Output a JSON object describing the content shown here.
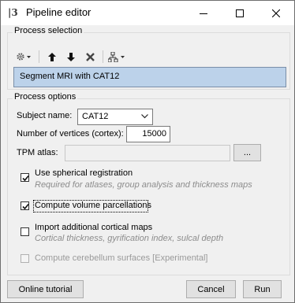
{
  "window": {
    "title": "Pipeline editor",
    "app_icon": "brainstorm-icon"
  },
  "process_selection": {
    "label": "Process selection",
    "selected_process": "Segment MRI with CAT12"
  },
  "process_options": {
    "label": "Process options",
    "subject_name_label": "Subject name:",
    "subject_name_value": "CAT12",
    "vertices_label": "Number of vertices (cortex):",
    "vertices_value": "15000",
    "tpm_label": "TPM atlas:",
    "tpm_value": "",
    "browse_label": "...",
    "options": [
      {
        "label": "Use spherical registration",
        "desc": "Required for atlases, group analysis and thickness maps",
        "checked": true,
        "enabled": true
      },
      {
        "label": "Compute volume parcellations",
        "desc": "",
        "checked": true,
        "enabled": true
      },
      {
        "label": "Import additional cortical maps",
        "desc": "Cortical thickness, gyrification index, sulcal depth",
        "checked": false,
        "enabled": true
      },
      {
        "label": "Compute cerebellum surfaces [Experimental]",
        "desc": "",
        "checked": false,
        "enabled": false
      }
    ]
  },
  "footer": {
    "tutorial_label": "Online tutorial",
    "cancel_label": "Cancel",
    "run_label": "Run"
  },
  "colors": {
    "selection_bg": "#bcd2ea",
    "window_bg": "#f0f0f0"
  }
}
